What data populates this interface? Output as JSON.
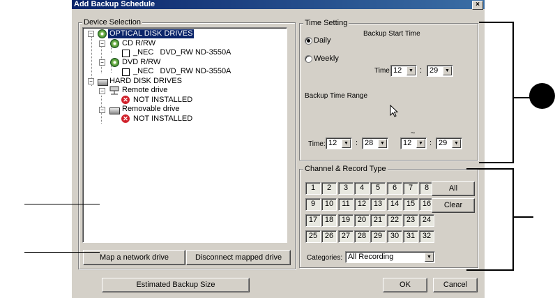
{
  "window": {
    "title": "Add Backup Schedule",
    "close_label": "×"
  },
  "device_selection": {
    "legend": "Device Selection",
    "tree": [
      {
        "label": "OPTICAL DISK DRIVES",
        "icon": "disc-icon",
        "selected": true
      },
      {
        "label": "CD R/RW",
        "icon": "disc-icon"
      },
      {
        "label": "_NEC   DVD_RW ND-3550A",
        "icon": "checkbox"
      },
      {
        "label": "DVD R/RW",
        "icon": "disc-icon"
      },
      {
        "label": "_NEC   DVD_RW ND-3550A",
        "icon": "checkbox"
      },
      {
        "label": "HARD DISK DRIVES",
        "icon": "hdd-icon"
      },
      {
        "label": "Remote drive",
        "icon": "network-drive-icon"
      },
      {
        "label": "NOT INSTALLED",
        "icon": "error-icon"
      },
      {
        "label": "Removable drive",
        "icon": "hdd-icon"
      },
      {
        "label": "NOT INSTALLED",
        "icon": "error-icon"
      }
    ],
    "map_button": "Map a network drive",
    "disconnect_button": "Disconnect mapped drive"
  },
  "time_setting": {
    "legend": "Time Setting",
    "daily_label": "Daily",
    "weekly_label": "Weekly",
    "selected": "Daily",
    "backup_start_label": "Backup Start Time",
    "time_label": "Time:",
    "start_hour": "12",
    "start_min": "29",
    "colon": ":",
    "range_label": "Backup Time Range",
    "range_time_label": "Time:",
    "range_from_hour": "12",
    "range_from_min": "28",
    "tilde": "~",
    "range_to_hour": "12",
    "range_to_min": "29"
  },
  "channel": {
    "legend": "Channel & Record Type",
    "channels": [
      "1",
      "2",
      "3",
      "4",
      "5",
      "6",
      "7",
      "8",
      "9",
      "10",
      "11",
      "12",
      "13",
      "14",
      "15",
      "16",
      "17",
      "18",
      "19",
      "20",
      "21",
      "22",
      "23",
      "24",
      "25",
      "26",
      "27",
      "28",
      "29",
      "30",
      "31",
      "32"
    ],
    "all_button": "All",
    "clear_button": "Clear",
    "categories_label": "Categories:",
    "categories_value": "All Recording"
  },
  "footer": {
    "estimate_button": "Estimated Backup Size",
    "ok_button": "OK",
    "cancel_button": "Cancel"
  }
}
